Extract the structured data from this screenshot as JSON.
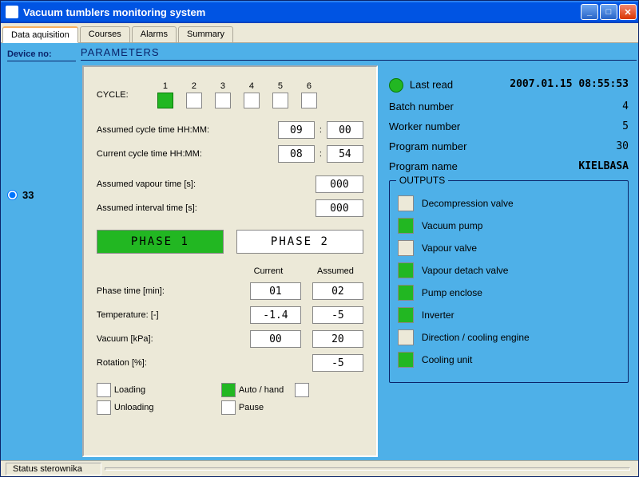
{
  "window": {
    "title": "Vacuum tumblers monitoring system"
  },
  "tabs": [
    "Data aquisition",
    "Courses",
    "Alarms",
    "Summary"
  ],
  "active_tab": 0,
  "left": {
    "header": "Device no:",
    "device": "33"
  },
  "params": {
    "header": "PARAMETERS",
    "cycle_label": "CYCLE:",
    "cycle_count": 6,
    "cycle_selected": 1,
    "assumed_cycle_label": "Assumed cycle time  HH:MM:",
    "assumed_cycle_hh": "09",
    "assumed_cycle_mm": "00",
    "current_cycle_label": "Current cycle time  HH:MM:",
    "current_cycle_hh": "08",
    "current_cycle_mm": "54",
    "assumed_vapour_label": "Assumed vapour time [s]:",
    "assumed_vapour": "000",
    "assumed_interval_label": "Assumed interval time [s]:",
    "assumed_interval": "000",
    "phase1": "PHASE 1",
    "phase2": "PHASE 2",
    "phase_active": 1,
    "col_current": "Current",
    "col_assumed": "Assumed",
    "phase_time_label": "Phase time [min]:",
    "phase_time_cur": "01",
    "phase_time_asm": "02",
    "temp_label": "Temperature:  [-]",
    "temp_cur": "-1.4",
    "temp_asm": "-5",
    "vacuum_label": "Vacuum [kPa]:",
    "vacuum_cur": "00",
    "vacuum_asm": "20",
    "rotation_label": "Rotation [%]:",
    "rotation_cur": "-5",
    "loading_label": "Loading",
    "unloading_label": "Unloading",
    "autohand_label": "Auto / hand",
    "autohand_on": true,
    "pause_label": "Pause"
  },
  "right": {
    "last_read_label": "Last read",
    "timestamp": "2007.01.15 08:55:53",
    "batch_label": "Batch number",
    "batch": "4",
    "worker_label": "Worker number",
    "worker": "5",
    "program_num_label": "Program number",
    "program_num": "30",
    "program_name_label": "Program name",
    "program_name": "KIELBASA",
    "outputs_header": "OUTPUTS",
    "outputs": [
      {
        "label": "Decompression valve",
        "on": false
      },
      {
        "label": "Vacuum pump",
        "on": true
      },
      {
        "label": "Vapour valve",
        "on": false
      },
      {
        "label": "Vapour detach valve",
        "on": true
      },
      {
        "label": "Pump enclose",
        "on": true
      },
      {
        "label": "Inverter",
        "on": true
      },
      {
        "label": "Direction / cooling engine",
        "on": false
      },
      {
        "label": "Cooling unit",
        "on": true
      }
    ]
  },
  "status": "Status sterownika"
}
